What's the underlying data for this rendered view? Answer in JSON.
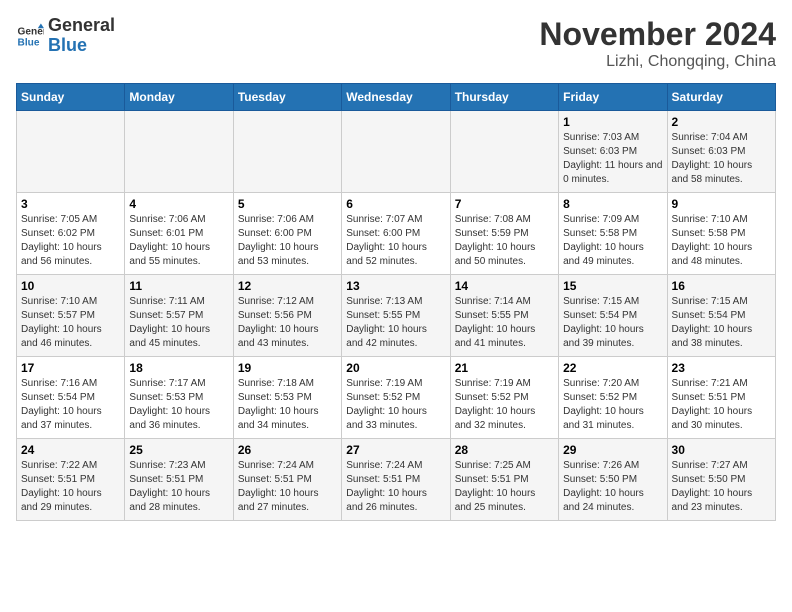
{
  "header": {
    "logo": {
      "line1": "General",
      "line2": "Blue"
    },
    "month": "November 2024",
    "location": "Lizhi, Chongqing, China"
  },
  "days_of_week": [
    "Sunday",
    "Monday",
    "Tuesday",
    "Wednesday",
    "Thursday",
    "Friday",
    "Saturday"
  ],
  "weeks": [
    [
      {
        "date": "",
        "info": ""
      },
      {
        "date": "",
        "info": ""
      },
      {
        "date": "",
        "info": ""
      },
      {
        "date": "",
        "info": ""
      },
      {
        "date": "",
        "info": ""
      },
      {
        "date": "1",
        "info": "Sunrise: 7:03 AM\nSunset: 6:03 PM\nDaylight: 11 hours and 0 minutes."
      },
      {
        "date": "2",
        "info": "Sunrise: 7:04 AM\nSunset: 6:03 PM\nDaylight: 10 hours and 58 minutes."
      }
    ],
    [
      {
        "date": "3",
        "info": "Sunrise: 7:05 AM\nSunset: 6:02 PM\nDaylight: 10 hours and 56 minutes."
      },
      {
        "date": "4",
        "info": "Sunrise: 7:06 AM\nSunset: 6:01 PM\nDaylight: 10 hours and 55 minutes."
      },
      {
        "date": "5",
        "info": "Sunrise: 7:06 AM\nSunset: 6:00 PM\nDaylight: 10 hours and 53 minutes."
      },
      {
        "date": "6",
        "info": "Sunrise: 7:07 AM\nSunset: 6:00 PM\nDaylight: 10 hours and 52 minutes."
      },
      {
        "date": "7",
        "info": "Sunrise: 7:08 AM\nSunset: 5:59 PM\nDaylight: 10 hours and 50 minutes."
      },
      {
        "date": "8",
        "info": "Sunrise: 7:09 AM\nSunset: 5:58 PM\nDaylight: 10 hours and 49 minutes."
      },
      {
        "date": "9",
        "info": "Sunrise: 7:10 AM\nSunset: 5:58 PM\nDaylight: 10 hours and 48 minutes."
      }
    ],
    [
      {
        "date": "10",
        "info": "Sunrise: 7:10 AM\nSunset: 5:57 PM\nDaylight: 10 hours and 46 minutes."
      },
      {
        "date": "11",
        "info": "Sunrise: 7:11 AM\nSunset: 5:57 PM\nDaylight: 10 hours and 45 minutes."
      },
      {
        "date": "12",
        "info": "Sunrise: 7:12 AM\nSunset: 5:56 PM\nDaylight: 10 hours and 43 minutes."
      },
      {
        "date": "13",
        "info": "Sunrise: 7:13 AM\nSunset: 5:55 PM\nDaylight: 10 hours and 42 minutes."
      },
      {
        "date": "14",
        "info": "Sunrise: 7:14 AM\nSunset: 5:55 PM\nDaylight: 10 hours and 41 minutes."
      },
      {
        "date": "15",
        "info": "Sunrise: 7:15 AM\nSunset: 5:54 PM\nDaylight: 10 hours and 39 minutes."
      },
      {
        "date": "16",
        "info": "Sunrise: 7:15 AM\nSunset: 5:54 PM\nDaylight: 10 hours and 38 minutes."
      }
    ],
    [
      {
        "date": "17",
        "info": "Sunrise: 7:16 AM\nSunset: 5:54 PM\nDaylight: 10 hours and 37 minutes."
      },
      {
        "date": "18",
        "info": "Sunrise: 7:17 AM\nSunset: 5:53 PM\nDaylight: 10 hours and 36 minutes."
      },
      {
        "date": "19",
        "info": "Sunrise: 7:18 AM\nSunset: 5:53 PM\nDaylight: 10 hours and 34 minutes."
      },
      {
        "date": "20",
        "info": "Sunrise: 7:19 AM\nSunset: 5:52 PM\nDaylight: 10 hours and 33 minutes."
      },
      {
        "date": "21",
        "info": "Sunrise: 7:19 AM\nSunset: 5:52 PM\nDaylight: 10 hours and 32 minutes."
      },
      {
        "date": "22",
        "info": "Sunrise: 7:20 AM\nSunset: 5:52 PM\nDaylight: 10 hours and 31 minutes."
      },
      {
        "date": "23",
        "info": "Sunrise: 7:21 AM\nSunset: 5:51 PM\nDaylight: 10 hours and 30 minutes."
      }
    ],
    [
      {
        "date": "24",
        "info": "Sunrise: 7:22 AM\nSunset: 5:51 PM\nDaylight: 10 hours and 29 minutes."
      },
      {
        "date": "25",
        "info": "Sunrise: 7:23 AM\nSunset: 5:51 PM\nDaylight: 10 hours and 28 minutes."
      },
      {
        "date": "26",
        "info": "Sunrise: 7:24 AM\nSunset: 5:51 PM\nDaylight: 10 hours and 27 minutes."
      },
      {
        "date": "27",
        "info": "Sunrise: 7:24 AM\nSunset: 5:51 PM\nDaylight: 10 hours and 26 minutes."
      },
      {
        "date": "28",
        "info": "Sunrise: 7:25 AM\nSunset: 5:51 PM\nDaylight: 10 hours and 25 minutes."
      },
      {
        "date": "29",
        "info": "Sunrise: 7:26 AM\nSunset: 5:50 PM\nDaylight: 10 hours and 24 minutes."
      },
      {
        "date": "30",
        "info": "Sunrise: 7:27 AM\nSunset: 5:50 PM\nDaylight: 10 hours and 23 minutes."
      }
    ]
  ]
}
